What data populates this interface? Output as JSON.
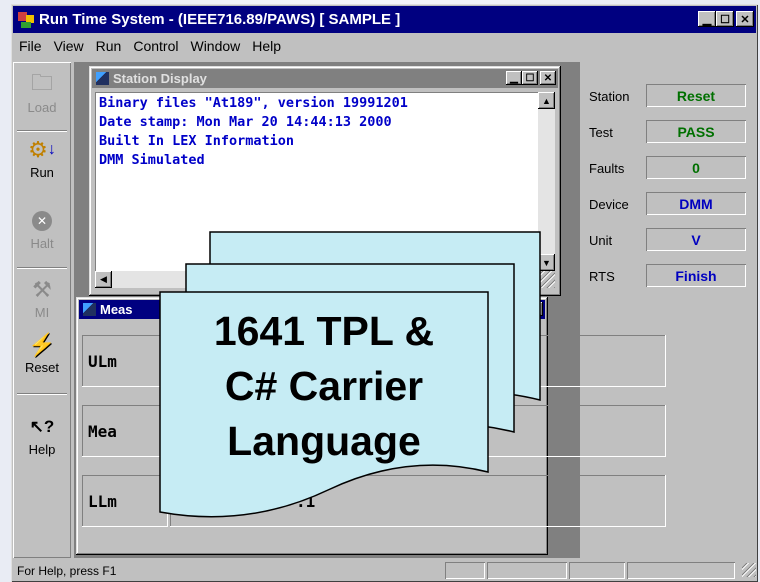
{
  "window": {
    "title": "Run Time System - (IEEE716.89/PAWS)  [ SAMPLE ]"
  },
  "menu": [
    "File",
    "View",
    "Run",
    "Control",
    "Window",
    "Help"
  ],
  "toolbar": {
    "load": "Load",
    "run": "Run",
    "halt": "Halt",
    "mi": "MI",
    "reset": "Reset",
    "help": "Help"
  },
  "station_display": {
    "title": "Station Display",
    "lines": [
      "Binary files \"At189\", version 19991201",
      "Date stamp: Mon Mar 20 14:44:13 2000",
      "Built In LEX Information",
      "DMM Simulated"
    ]
  },
  "measurement": {
    "title": "Meas",
    "rows": [
      {
        "label": "ULm",
        "value": ""
      },
      {
        "label": "Mea",
        "value": ""
      },
      {
        "label": "LLm",
        "value": ".1"
      }
    ]
  },
  "status": [
    {
      "label": "Station",
      "value": "Reset"
    },
    {
      "label": "Test",
      "value": "PASS"
    },
    {
      "label": "Faults",
      "value": "0"
    },
    {
      "label": "Device",
      "value": "DMM"
    },
    {
      "label": "Unit",
      "value": "V"
    },
    {
      "label": "RTS",
      "value": "Finish"
    }
  ],
  "statusbar": {
    "text": "For Help, press F1"
  },
  "overlay": {
    "lines": [
      "1641 TPL &",
      "C# Carrier",
      "Language"
    ]
  },
  "colors": {
    "title_bar": "#000080",
    "console_text": "#0000c8",
    "status_green": "#007000",
    "status_blue": "#0000c0",
    "overlay_fill": "#c6ecf4"
  }
}
